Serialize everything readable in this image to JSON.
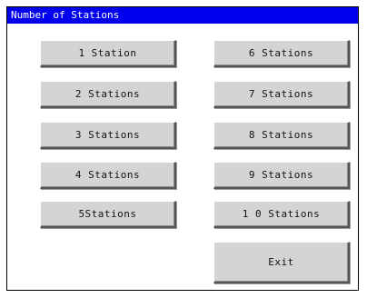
{
  "window": {
    "title": "Number of Stations"
  },
  "buttons": {
    "left": [
      "1 Station",
      "2 Stations",
      "3 Stations",
      "4 Stations",
      "5Stations"
    ],
    "right": [
      "6 Stations",
      "7 Stations",
      "8 Stations",
      "9 Stations",
      "1 0 Stations"
    ],
    "exit": "Exit"
  }
}
